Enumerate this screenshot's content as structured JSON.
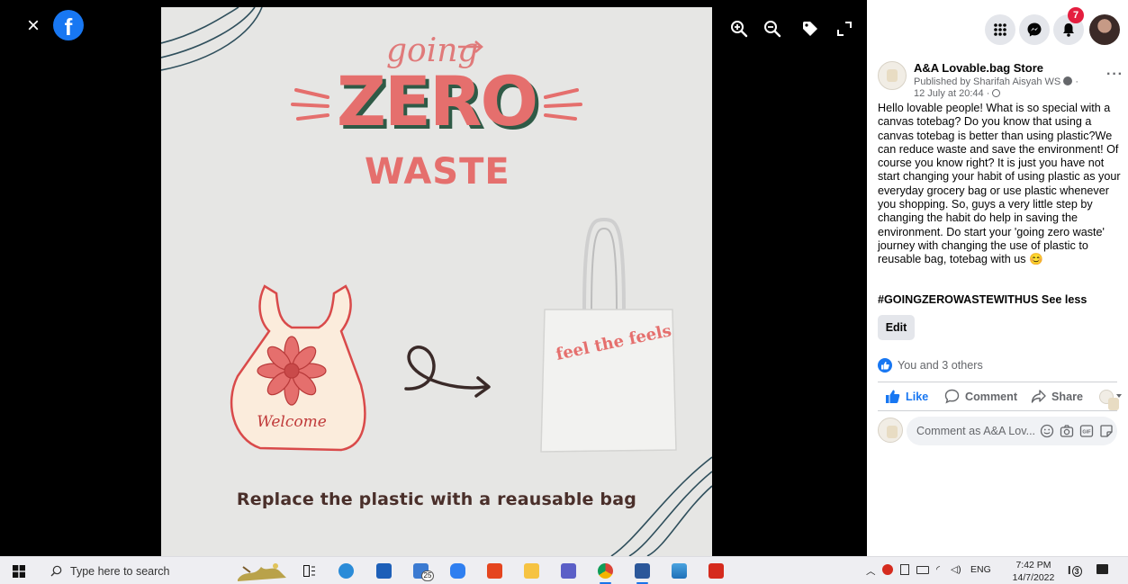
{
  "viewer": {
    "close_symbol": "×",
    "logo_letter": "f",
    "tools": [
      "zoom-in-icon",
      "zoom-out-icon",
      "tag-icon",
      "fullscreen-icon"
    ]
  },
  "poster": {
    "title_going": "going",
    "title_zero": "ZERO",
    "title_waste": "WASTE",
    "bag_left_text": "Welcome",
    "bag_right_text": "feel the feels",
    "caption": "Replace the plastic with a reausable bag"
  },
  "topbar": {
    "icons": [
      "menu-grid-icon",
      "messenger-icon",
      "notifications-icon"
    ],
    "notification_count": "7"
  },
  "post": {
    "page_name": "A&A Lovable.bag Store",
    "published_by": "Published by Sharifah Aisyah WS",
    "time": "12 July at 20:44 ·",
    "more": "···",
    "body_lines": [
      "Hello lovable people! What is so special with a",
      "canvas totebag? Do you know that using a",
      "canvas totebag is better than using plastic?We",
      "can reduce waste and save the environment! Of",
      "course you know right? It is just you have not",
      "start changing your habit of using plastic as your",
      "everyday grocery bag or use plastic whenever",
      "you shopping. So, guys a very little step by",
      "changing the habit do help in saving the",
      "environment. Do start your 'going zero waste'",
      "journey with changing the use of plastic to",
      "reusable bag, totebag with us 😊"
    ],
    "hashtag": "#GOINGZEROWASTEWITHUS See less",
    "edit_label": "Edit",
    "reactions_text": "You and 3 others",
    "actions": {
      "like": "Like",
      "comment": "Comment",
      "share": "Share"
    },
    "comment_placeholder": "Comment as A&A Lov..."
  },
  "taskbar": {
    "search_placeholder": "Type here to search",
    "store_badge": "25",
    "tray_language": "ENG",
    "clock_time": "7:42 PM",
    "clock_date": "14/7/2022",
    "notif_count": "3"
  },
  "colors": {
    "facebook_blue": "#1877f2",
    "badge_red": "#e41e3f",
    "poster_bg": "#e6e6e4",
    "zero_pink": "#e56f6d",
    "zero_shadow": "#2f5a46"
  }
}
